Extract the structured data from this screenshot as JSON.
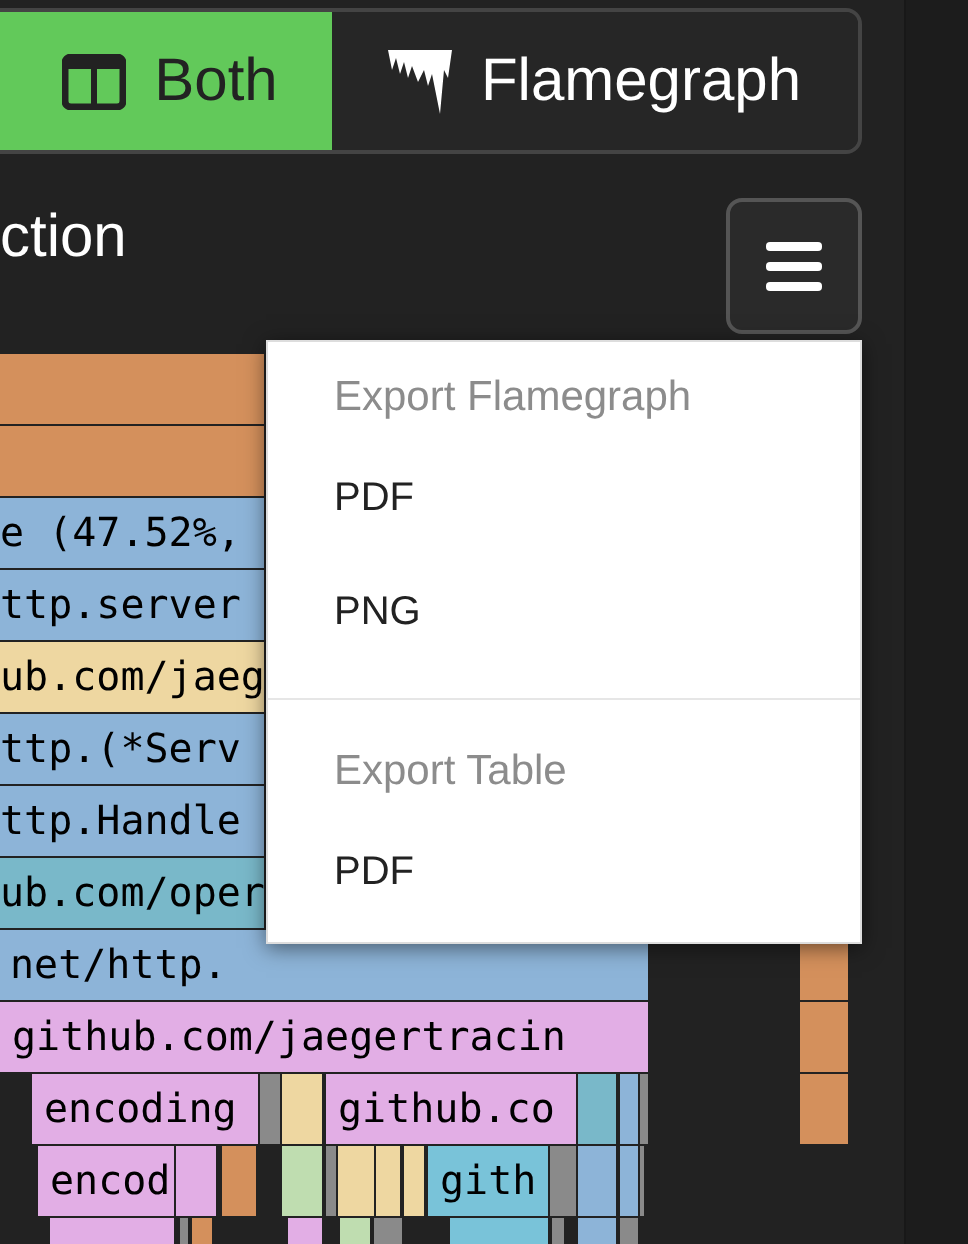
{
  "view_toggle": [
    {
      "label": "Both",
      "selected": true
    },
    {
      "label": "Flamegraph",
      "selected": false
    }
  ],
  "title": "ction",
  "menu_button": {
    "expanded": true
  },
  "export_menu": {
    "sections": [
      {
        "heading": "Export Flamegraph",
        "items": [
          "PDF",
          "PNG"
        ]
      },
      {
        "heading": "Export Table",
        "items": [
          "PDF"
        ]
      }
    ]
  },
  "flamegraph": {
    "rows": [
      [
        {
          "color": "#d4905c"
        }
      ],
      [
        {
          "color": "#d4905c"
        }
      ],
      [
        {
          "color": "#8db4d8",
          "label": "e (47.52%,"
        }
      ],
      [
        {
          "color": "#8db4d8",
          "label": "ttp.server"
        }
      ],
      [
        {
          "color": "#eed7a1",
          "label": "ub.com/jaeg"
        }
      ],
      [
        {
          "color": "#8db4d8",
          "label": "ttp.(*Serv"
        }
      ],
      [
        {
          "color": "#8db4d8",
          "label": "ttp.Handle"
        }
      ],
      [
        {
          "color": "#79b8c9",
          "label": "ub.com/oper"
        }
      ],
      [
        {
          "color": "#8db4d8",
          "label": "net/http."
        },
        {
          "color": "#d4905c"
        }
      ],
      [
        {
          "color": "#e2aee5",
          "label": "github.com/jaegertracin"
        },
        {
          "color": "#d4905c"
        }
      ],
      [
        {
          "color": "#e2aee5",
          "label": "encoding"
        },
        {
          "color": "#8a8a8a"
        },
        {
          "color": "#eed7a1"
        },
        {
          "color": "#e2aee5",
          "label": "github.co"
        },
        {
          "color": "#79b8c9"
        },
        {
          "color": "#8db4d8"
        },
        {
          "color": "#8a8a8a"
        },
        {
          "color": "#d4905c"
        }
      ],
      [
        {
          "color": "#e2aee5",
          "label": "encod"
        },
        {
          "color": "#e2aee5"
        },
        {
          "color": "#d4905c"
        },
        {
          "color": "#bfddb0"
        },
        {
          "color": "#8a8a8a"
        },
        {
          "color": "#eed7a1"
        },
        {
          "color": "#eed7a1"
        },
        {
          "color": "#eed7a1"
        },
        {
          "color": "#79c3d9",
          "label": "gith"
        },
        {
          "color": "#8a8a8a"
        },
        {
          "color": "#8db4d8"
        },
        {
          "color": "#8db4d8"
        },
        {
          "color": "#8a8a8a"
        }
      ],
      [
        {
          "color": "#e2aee5"
        },
        {
          "color": "#8a8a8a"
        },
        {
          "color": "#d4905c"
        },
        {
          "color": "#e2aee5"
        },
        {
          "color": "#bfddb0"
        },
        {
          "color": "#8a8a8a"
        },
        {
          "color": "#79c3d9"
        },
        {
          "color": "#8a8a8a"
        },
        {
          "color": "#8db4d8"
        },
        {
          "color": "#8a8a8a"
        }
      ]
    ]
  }
}
